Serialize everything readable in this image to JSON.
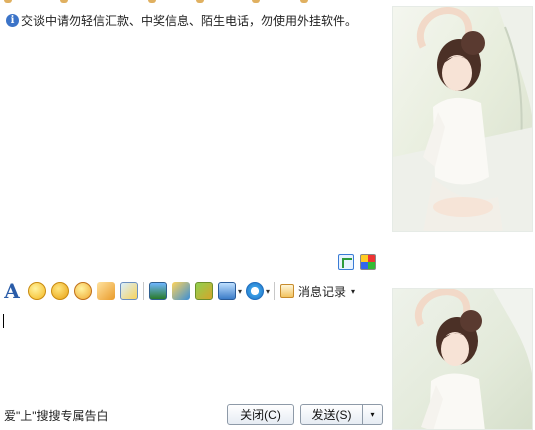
{
  "message": {
    "notice_icon": "info-icon",
    "notice": "交谈中请勿轻信汇款、中奖信息、陌生电话，勿使用外挂软件。"
  },
  "toolbar": {
    "items": [
      {
        "name": "font-icon",
        "glyph": "A"
      },
      {
        "name": "emoticon-icon"
      },
      {
        "name": "animated-emoticon-icon"
      },
      {
        "name": "magic-emoticon-icon"
      },
      {
        "name": "nudge-icon"
      },
      {
        "name": "doodle-icon"
      },
      {
        "name": "image-icon"
      },
      {
        "name": "music-icon"
      },
      {
        "name": "gift-icon"
      },
      {
        "name": "screenshot-icon"
      },
      {
        "name": "soso-icon"
      }
    ],
    "history_label": "消息记录",
    "dropdown_glyph": "▾"
  },
  "footer": {
    "slogan": "爱\"上\"搜搜专属告白",
    "close_label": "关闭(C)",
    "send_label": "发送(S)",
    "send_arrow": "▾"
  },
  "colors": {
    "accent": "#3c74c8",
    "button_border": "#8e9aa8"
  }
}
